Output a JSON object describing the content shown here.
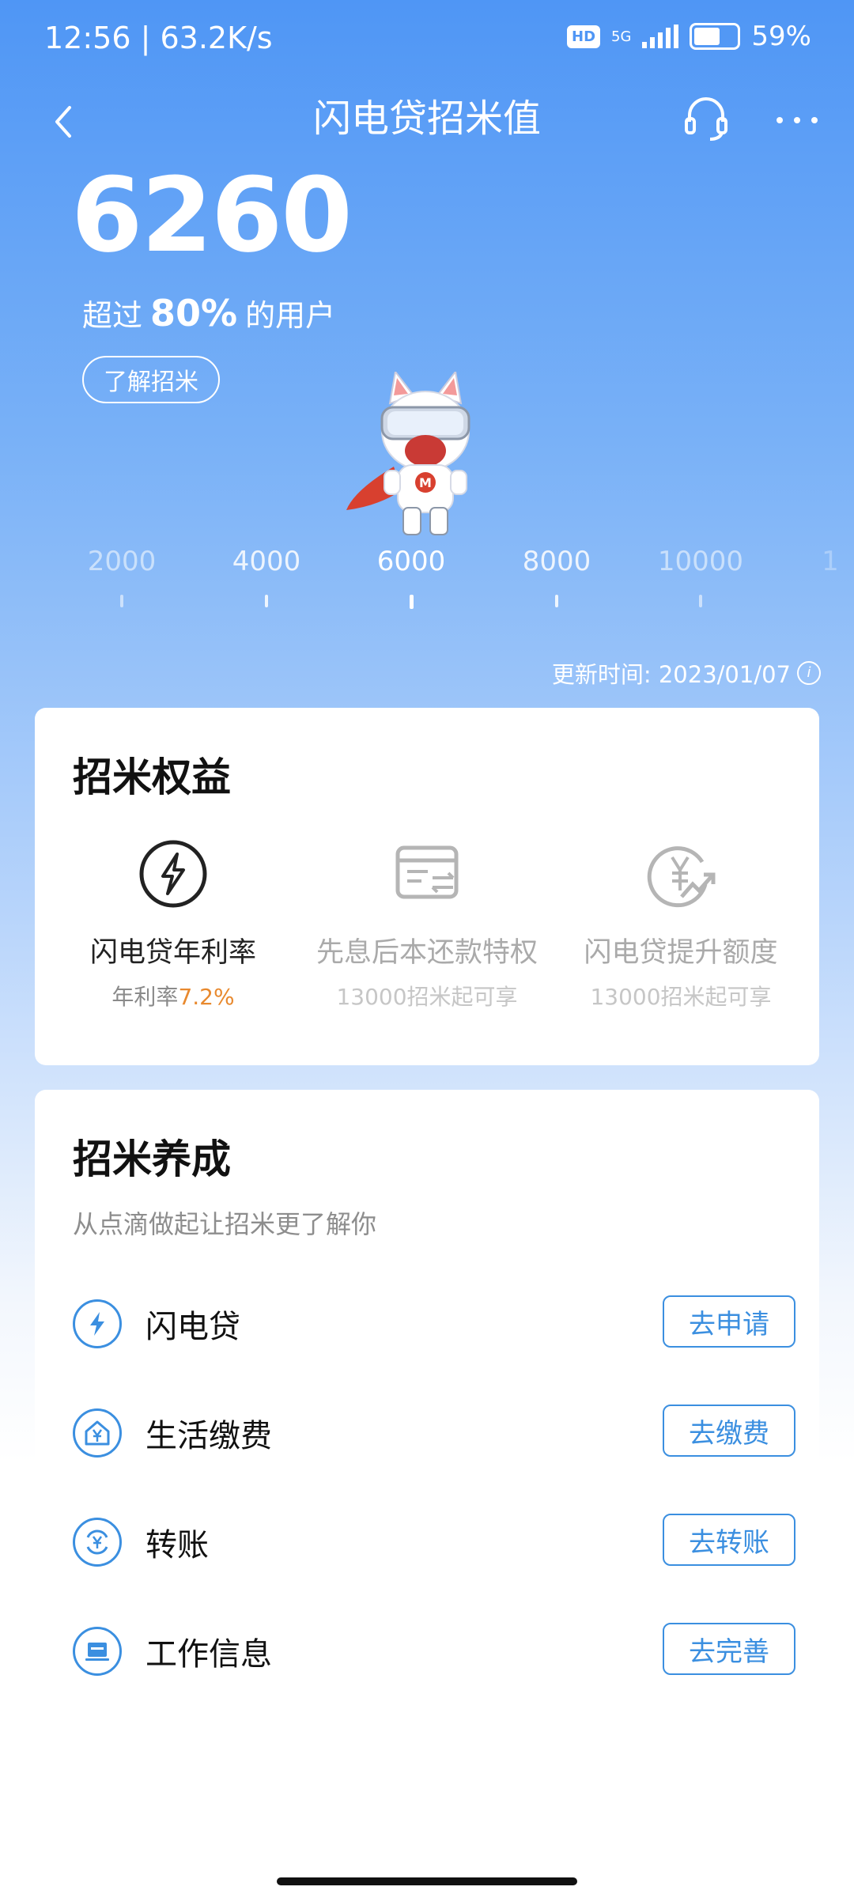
{
  "status_bar": {
    "time_speed": "12:56 | 63.2K/s",
    "network": "5G",
    "battery": "59%",
    "hd": "HD"
  },
  "nav": {
    "title": "闪电贷招米值"
  },
  "score": {
    "value": "6260",
    "prefix": "超过",
    "percent": "80%",
    "suffix": "的用户",
    "learn_button": "了解招米"
  },
  "scale": {
    "ticks": [
      "2000",
      "4000",
      "6000",
      "8000",
      "10000",
      "1"
    ],
    "current_value": 6260
  },
  "update_time": "更新时间: 2023/01/07",
  "rights": {
    "title": "招米权益",
    "items": [
      {
        "label": "闪电贷年利率",
        "sub_prefix": "年利率",
        "sub_value": "7.2%",
        "icon": "lightning-icon",
        "locked": false
      },
      {
        "label": "先息后本还款特权",
        "sub": "13000招米起可享",
        "icon": "card-exchange-icon",
        "locked": true
      },
      {
        "label": "闪电贷提升额度",
        "sub": "13000招米起可享",
        "icon": "yen-up-icon",
        "locked": true
      }
    ]
  },
  "cultivate": {
    "title": "招米养成",
    "subtitle": "从点滴做起让招米更了解你",
    "tasks": [
      {
        "label": "闪电贷",
        "button": "去申请",
        "icon": "lightning-icon"
      },
      {
        "label": "生活缴费",
        "button": "去缴费",
        "icon": "house-yen-icon"
      },
      {
        "label": "转账",
        "button": "去转账",
        "icon": "transfer-icon"
      },
      {
        "label": "工作信息",
        "button": "去完善",
        "icon": "laptop-icon"
      }
    ]
  },
  "colors": {
    "accent": "#3b8fe0",
    "rate_highlight": "#e8892e",
    "header_top": "#4f96f5"
  }
}
